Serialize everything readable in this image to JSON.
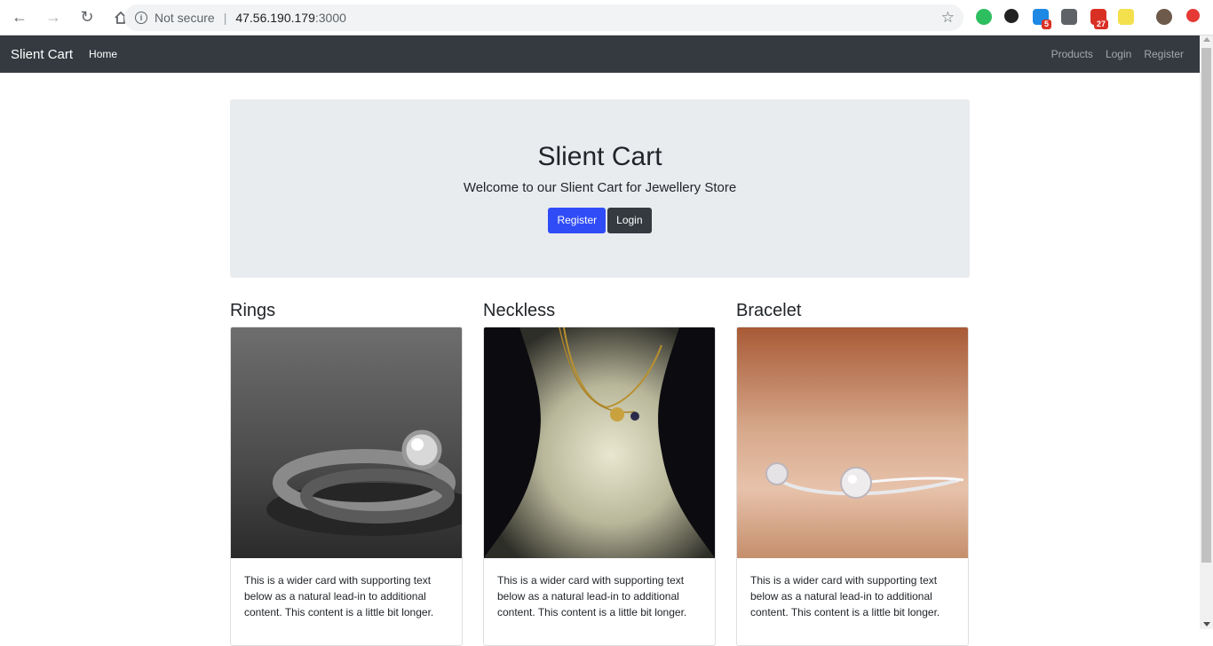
{
  "browser": {
    "security_label": "Not secure",
    "url_host": "47.56.190.179",
    "url_port": ":3000",
    "badges": {
      "todo": "5",
      "mail": "27"
    }
  },
  "navbar": {
    "brand": "Slient Cart",
    "home": "Home",
    "links": [
      "Products",
      "Login",
      "Register"
    ]
  },
  "jumbotron": {
    "title": "Slient Cart",
    "subtitle": "Welcome to our Slient Cart for Jewellery Store",
    "register_label": "Register",
    "login_label": "Login"
  },
  "categories": [
    {
      "title": "Rings",
      "text": "This is a wider card with supporting text below as a natural lead-in to additional content. This content is a little bit longer."
    },
    {
      "title": "Neckless",
      "text": "This is a wider card with supporting text below as a natural lead-in to additional content. This content is a little bit longer."
    },
    {
      "title": "Bracelet",
      "text": "This is a wider card with supporting text below as a natural lead-in to additional content. This content is a little bit longer."
    }
  ],
  "colors": {
    "navbar": "#343a40",
    "primary": "#2f4cf7",
    "jumbotron": "#e9ecef"
  }
}
